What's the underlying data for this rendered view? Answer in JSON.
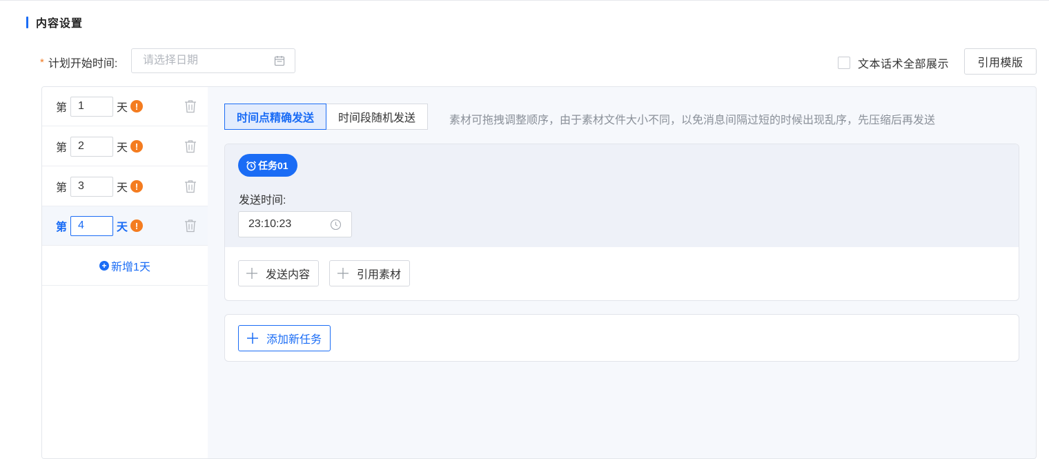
{
  "section": {
    "title": "内容设置"
  },
  "plan": {
    "required_mark": "*",
    "label": "计划开始时间:",
    "date_placeholder": "请选择日期"
  },
  "options": {
    "show_all_scripts_label": "文本话术全部展示",
    "show_all_scripts_checked": false,
    "template_button": "引用模版"
  },
  "days": [
    {
      "prefix": "第",
      "value": "1",
      "suffix": "天",
      "warn": "!",
      "active": false
    },
    {
      "prefix": "第",
      "value": "2",
      "suffix": "天",
      "warn": "!",
      "active": false
    },
    {
      "prefix": "第",
      "value": "3",
      "suffix": "天",
      "warn": "!",
      "active": false
    },
    {
      "prefix": "第",
      "value": "4",
      "suffix": "天",
      "warn": "!",
      "active": true
    }
  ],
  "add_day": {
    "icon": "+",
    "label": "新增1天"
  },
  "modes": {
    "tabs": [
      {
        "label": "时间点精确发送",
        "active": true
      },
      {
        "label": "时间段随机发送",
        "active": false
      }
    ],
    "hint": "素材可拖拽调整顺序，由于素材文件大小不同，以免消息间隔过短的时候出现乱序，先压缩后再发送"
  },
  "task": {
    "badge": "任务01",
    "send_time_label": "发送时间:",
    "send_time_value": "23:10:23",
    "actions": {
      "send_content": "发送内容",
      "use_material": "引用素材"
    }
  },
  "add_task": {
    "label": "添加新任务"
  },
  "colors": {
    "accent": "#1a6cf5",
    "warning": "#f47c20",
    "panel_bg": "#f6f8fc",
    "task_head_bg": "#eef1f8"
  }
}
